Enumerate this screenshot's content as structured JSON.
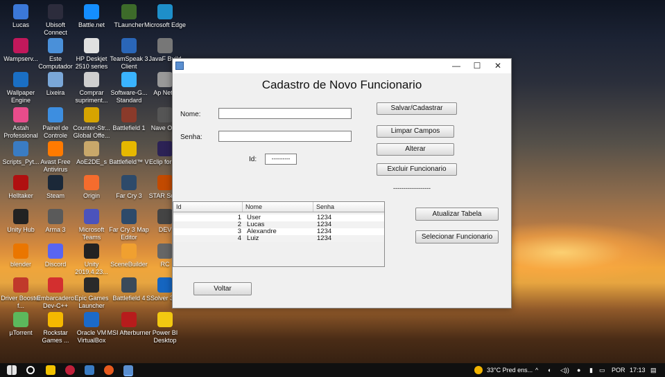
{
  "desktop_icons": [
    {
      "label": "Lucas",
      "color": "#3b78d8"
    },
    {
      "label": "Ubisoft Connect",
      "color": "#2c2c3c"
    },
    {
      "label": "Battle.net",
      "color": "#148eff"
    },
    {
      "label": "TLauncher",
      "color": "#3d6b2a"
    },
    {
      "label": "Microsoft Edge",
      "color": "#1e8fc9"
    },
    {
      "label": "Wampserv...",
      "color": "#c2185b"
    },
    {
      "label": "Este Computador",
      "color": "#4a90d9"
    },
    {
      "label": "HP Deskjet 2510 series",
      "color": "#e0e0e0"
    },
    {
      "label": "TeamSpeak 3 Client",
      "color": "#2a66b8"
    },
    {
      "label": "JavaF Build",
      "color": "#777777"
    },
    {
      "label": "Wallpaper Engine",
      "color": "#1a6fc4"
    },
    {
      "label": "Lixeira",
      "color": "#7aa7d8"
    },
    {
      "label": "Comprar supriment...",
      "color": "#cfcfcf"
    },
    {
      "label": "Software-G... Standard",
      "color": "#3ab4ff"
    },
    {
      "label": "Ap NetB",
      "color": "#999999"
    },
    {
      "label": "Astah Professional",
      "color": "#e84c8b"
    },
    {
      "label": "Painel de Controle",
      "color": "#3d8ee0"
    },
    {
      "label": "Counter-Str... Global Offe...",
      "color": "#d6a400"
    },
    {
      "label": "Battlefield 1",
      "color": "#8a3a2a"
    },
    {
      "label": "Nave Ope",
      "color": "#555555"
    },
    {
      "label": "Scripts_Pyt...",
      "color": "#3a7cc3"
    },
    {
      "label": "Avast Free Antivirus",
      "color": "#ff7a00"
    },
    {
      "label": "AoE2DE_s",
      "color": "#c9a86a"
    },
    {
      "label": "Battlefield™ V",
      "color": "#e6b800"
    },
    {
      "label": "Eclip for En",
      "color": "#2c2255"
    },
    {
      "label": "Helltaker",
      "color": "#b01010"
    },
    {
      "label": "Steam",
      "color": "#1b2838"
    },
    {
      "label": "Origin",
      "color": "#f56c2d"
    },
    {
      "label": "Far Cry 3",
      "color": "#2d4a6a"
    },
    {
      "label": "STAR Squa",
      "color": "#c24a00"
    },
    {
      "label": "Unity Hub",
      "color": "#222222"
    },
    {
      "label": "Arma 3",
      "color": "#5a5a5a"
    },
    {
      "label": "Microsoft Teams",
      "color": "#4b53bc"
    },
    {
      "label": "Far Cry 3 Map Editor",
      "color": "#2d4a6a"
    },
    {
      "label": "DEV",
      "color": "#444444"
    },
    {
      "label": "blender",
      "color": "#ea7600"
    },
    {
      "label": "Discord",
      "color": "#5865f2"
    },
    {
      "label": "Unity 2019.4.23...",
      "color": "#222222"
    },
    {
      "label": "SceneBuilder",
      "color": "#f0a030"
    },
    {
      "label": "RC",
      "color": "#666666"
    },
    {
      "label": "Driver Booster f...",
      "color": "#c0392b"
    },
    {
      "label": "Embarcadero Dev-C++",
      "color": "#d32f2f"
    },
    {
      "label": "Epic Games Launcher",
      "color": "#2a2a2a"
    },
    {
      "label": "Battlefield 4",
      "color": "#3a4a5a"
    },
    {
      "label": "SSolver 3.4.1",
      "color": "#1565c0"
    },
    {
      "label": "µTorrent",
      "color": "#5cb85c"
    },
    {
      "label": "Rockstar Games ...",
      "color": "#f5b800"
    },
    {
      "label": "Oracle VM VirtualBox",
      "color": "#1b6ac9"
    },
    {
      "label": "MSI Afterburner",
      "color": "#b71c1c"
    },
    {
      "label": "Power BI Desktop",
      "color": "#f2c811"
    }
  ],
  "window": {
    "title": "",
    "minimize": "—",
    "maximize": "☐",
    "close": "✕",
    "heading": "Cadastro de Novo Funcionario",
    "nome_label": "Nome:",
    "nome_value": "",
    "senha_label": "Senha:",
    "senha_value": "",
    "id_label": "Id:",
    "id_value": "----------",
    "btn_salvar": "Salvar/Cadastrar",
    "btn_limpar": "Limpar Campos",
    "btn_alterar": "Alterar",
    "btn_excluir": "Excluir Funcionario",
    "separator": "------------------",
    "btn_atualizar": "Atualizar Tabela",
    "btn_selecionar": "Selecionar Funcionario",
    "btn_voltar": "Voltar",
    "table": {
      "headers": [
        "Id",
        "Nome",
        "Senha"
      ],
      "rows": [
        {
          "id": "1",
          "nome": "User",
          "senha": "1234"
        },
        {
          "id": "2",
          "nome": "Lucas",
          "senha": "1234"
        },
        {
          "id": "3",
          "nome": "Alexandre",
          "senha": "1234"
        },
        {
          "id": "4",
          "nome": "Luiz",
          "senha": "1234"
        }
      ]
    }
  },
  "taskbar": {
    "weather": "33°C Pred ens...",
    "language": "POR",
    "time": "17:13"
  }
}
